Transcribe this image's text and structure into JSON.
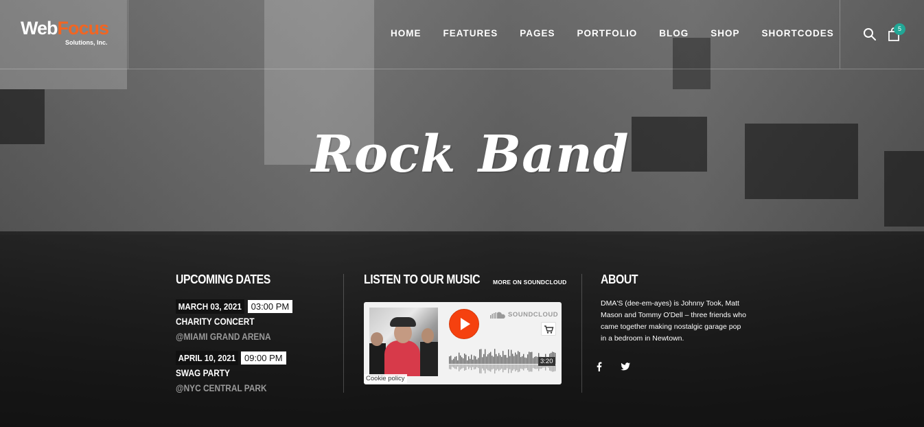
{
  "logo": {
    "brand_part1": "Web",
    "brand_part2": "Focus",
    "tagline": "Solutions, Inc."
  },
  "nav": {
    "items": [
      "HOME",
      "FEATURES",
      "PAGES",
      "PORTFOLIO",
      "BLOG",
      "SHOP",
      "SHORTCODES"
    ],
    "cart_count": "5"
  },
  "hero": {
    "title_left": "Rock",
    "title_right": "Band"
  },
  "upcoming": {
    "heading": "UPCOMING DATES",
    "events": [
      {
        "date": "MARCH 03, 2021",
        "time": "03:00 PM",
        "name": "CHARITY CONCERT",
        "venue": "@MIAMI GRAND ARENA"
      },
      {
        "date": "APRIL 10, 2021",
        "time": "09:00 PM",
        "name": "SWAG PARTY",
        "venue": "@NYC CENTRAL PARK"
      }
    ]
  },
  "music": {
    "heading": "LISTEN TO OUR MUSIC",
    "more_link": "MORE ON SOUNDCLOUD",
    "widget": {
      "brand": "SOUNDCLOUD",
      "duration": "3:20",
      "cookie": "Cookie policy"
    }
  },
  "about": {
    "heading": "ABOUT",
    "text": "DMA'S (dee-em-ayes) is Johnny Took, Matt Mason and Tommy O'Dell – three friends who came together making nostalgic garage pop in a bedroom in Newtown."
  },
  "social_icons": [
    "facebook-icon",
    "twitter-icon"
  ],
  "colors": {
    "accent": "#f26522",
    "soundcloud": "#f5410f",
    "badge": "#22a796"
  }
}
